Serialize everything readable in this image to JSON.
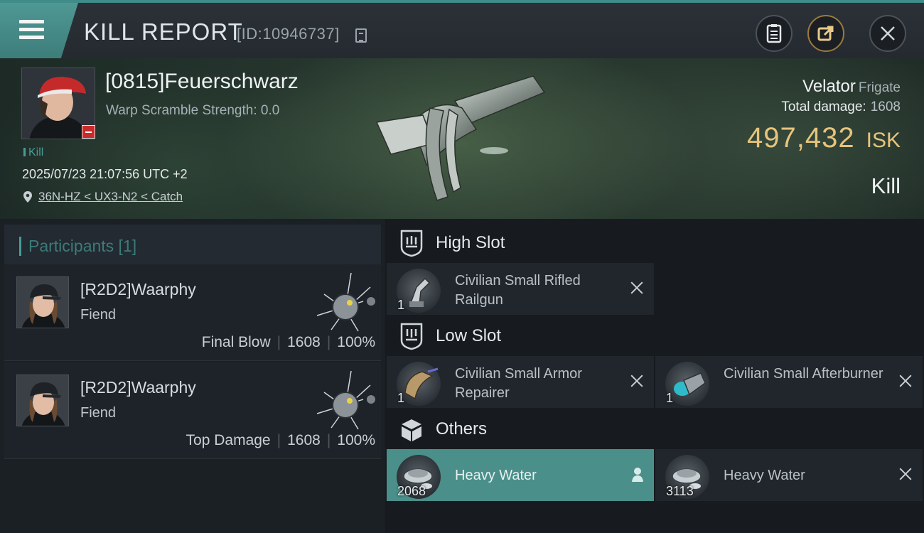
{
  "header": {
    "title": "KILL REPORT",
    "report_id": "[ID:10946737]"
  },
  "victim": {
    "name": "[0815]Feuerschwarz",
    "warp_scramble": "Warp Scramble Strength: 0.0",
    "tag": "Kill",
    "timestamp": "2025/07/23 21:07:56 UTC +2",
    "location": "36N-HZ < UX3-N2 < Catch",
    "ship_name": "Velator",
    "ship_class": "Frigate",
    "damage_label": "Total damage:",
    "damage_value": "1608",
    "isk_value": "497,432",
    "isk_unit": "ISK",
    "result": "Kill"
  },
  "participants": {
    "title": "Participants [1]",
    "rows": [
      {
        "name": "[R2D2]Waarphy",
        "ship": "Fiend",
        "role": "Final Blow",
        "damage": "1608",
        "percent": "100%"
      },
      {
        "name": "[R2D2]Waarphy",
        "ship": "Fiend",
        "role": "Top Damage",
        "damage": "1608",
        "percent": "100%"
      }
    ]
  },
  "fitting": {
    "high_slot": {
      "title": "High Slot",
      "modules": [
        {
          "name": "Civilian Small Rifled Railgun",
          "qty": "1"
        }
      ]
    },
    "low_slot": {
      "title": "Low Slot",
      "modules": [
        {
          "name": "Civilian Small Armor Repairer",
          "qty": "1"
        },
        {
          "name": "Civilian Small Afterburner",
          "qty": "1"
        }
      ]
    },
    "others": {
      "title": "Others",
      "modules": [
        {
          "name": "Heavy Water",
          "qty": "2068"
        },
        {
          "name": "Heavy Water",
          "qty": "3113"
        }
      ]
    }
  },
  "colors": {
    "accent": "#4a9b97",
    "isk": "#e6c47c",
    "highlight_row": "#4a8f8a",
    "security_badge": "#c92b2b"
  }
}
